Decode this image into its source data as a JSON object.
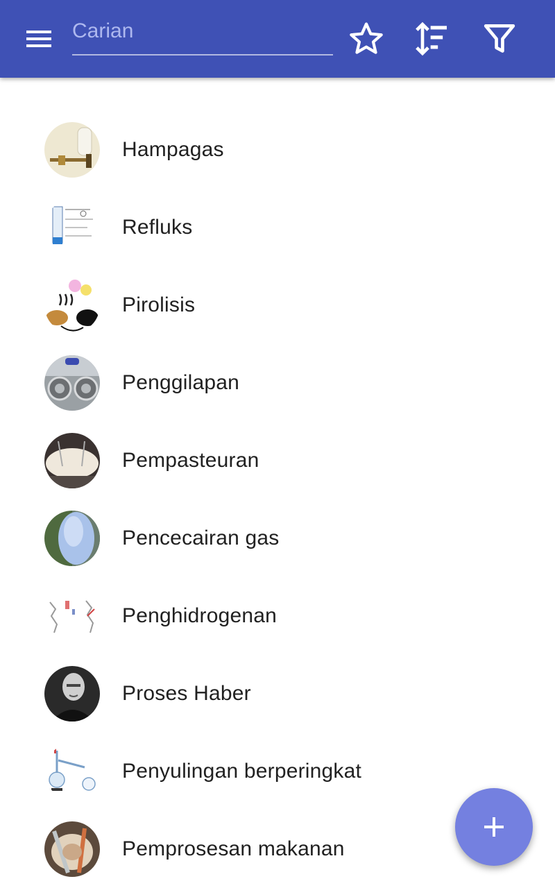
{
  "appbar": {
    "background": "#3f51b5",
    "menu_icon": "hamburger-menu-icon",
    "search": {
      "placeholder": "Carian",
      "value": ""
    },
    "actions": [
      {
        "name": "favorites",
        "icon": "star-outline-icon"
      },
      {
        "name": "sort",
        "icon": "sort-icon"
      },
      {
        "name": "filter",
        "icon": "filter-icon"
      }
    ]
  },
  "list": {
    "items": [
      {
        "label": "Hampagas",
        "thumb": "vacuum-pump-photo"
      },
      {
        "label": "Refluks",
        "thumb": "reflux-diagram"
      },
      {
        "label": "Pirolisis",
        "thumb": "pyrolysis-diagram"
      },
      {
        "label": "Penggilapan",
        "thumb": "polishing-photo"
      },
      {
        "label": "Pempasteuran",
        "thumb": "pasteurization-photo"
      },
      {
        "label": "Pencecairan gas",
        "thumb": "gas-liquefaction-photo"
      },
      {
        "label": "Penghidrogenan",
        "thumb": "hydrogenation-diagram"
      },
      {
        "label": "Proses Haber",
        "thumb": "haber-portrait-photo"
      },
      {
        "label": "Penyulingan berperingkat",
        "thumb": "fractional-distillation-diagram"
      },
      {
        "label": "Pemprosesan makanan",
        "thumb": "food-processing-photo"
      }
    ]
  },
  "fab": {
    "icon": "plus-icon",
    "color": "#7480e0"
  }
}
